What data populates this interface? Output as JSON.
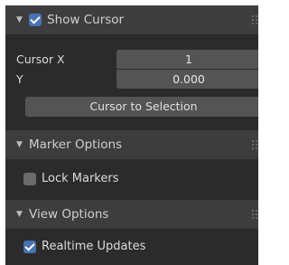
{
  "show_cursor": {
    "label": "Show Cursor",
    "checked": true,
    "cursor_x_label": "Cursor X",
    "cursor_x_value": "1",
    "y_label": "Y",
    "y_value": "0.000",
    "cursor_to_selection": "Cursor to Selection"
  },
  "marker_options": {
    "title": "Marker Options",
    "lock_markers": {
      "label": "Lock Markers",
      "checked": false
    }
  },
  "view_options": {
    "title": "View Options",
    "realtime_updates": {
      "label": "Realtime Updates",
      "checked": true
    }
  },
  "colors": {
    "panel_bg": "#2b2b2b",
    "header_bg": "#3d3d3d",
    "field_bg": "#545454",
    "accent": "#4772b3"
  },
  "icons": [
    "disclosure-triangle-icon",
    "checkbox-icon",
    "drag-grip-icon"
  ]
}
